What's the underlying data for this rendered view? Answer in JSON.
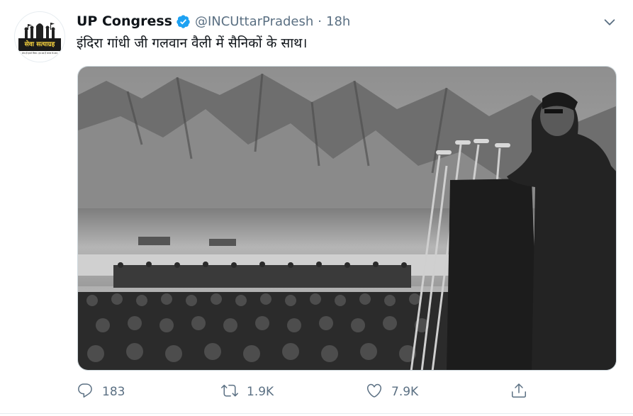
{
  "tweet": {
    "author_name": "UP Congress",
    "handle": "@INCUttarPradesh",
    "separator": "·",
    "time": "18h",
    "text": "इंदिरा गांधी जी गलवान वैली में सैनिकों के साथ।"
  },
  "avatar": {
    "banner_text": "सेवा सत्याग्रह",
    "tagline": "सेवा ही हमारे विचार, हम सब हैं जनता के साथ"
  },
  "actions": {
    "reply_count": "183",
    "retweet_count": "1.9K",
    "like_count": "7.9K"
  },
  "colors": {
    "verified": "#1da1f2",
    "icon_gray": "#5b7083",
    "text": "#0f1419"
  },
  "icons": [
    "verified-badge-icon",
    "chevron-down-icon",
    "reply-icon",
    "retweet-icon",
    "like-icon",
    "share-icon"
  ]
}
